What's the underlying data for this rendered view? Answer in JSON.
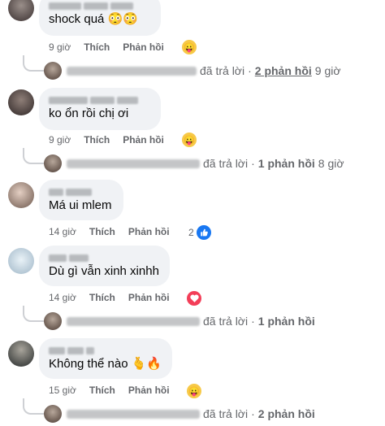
{
  "comments": [
    {
      "text": "shock quá 😳😳",
      "time": "9 giờ",
      "like": "Thích",
      "reply": "Phản hồi",
      "reaction": "haha-icon",
      "reply_summary": {
        "verb": "đã trả lời",
        "sep": "·",
        "count": "2 phản hồi",
        "ago": "9 giờ"
      }
    },
    {
      "text": "ko ổn rồi chị ơi",
      "time": "9 giờ",
      "like": "Thích",
      "reply": "Phản hồi",
      "reaction": "haha-icon",
      "reply_summary": {
        "verb": "đã trả lời",
        "sep": "·",
        "count": "1 phản hồi",
        "ago": "8 giờ"
      }
    },
    {
      "text": "Má ui mlem",
      "time": "14 giờ",
      "like": "Thích",
      "reply": "Phản hồi",
      "reaction_count": "2",
      "reaction": "like-icon"
    },
    {
      "text": "Dù gì vẫn xinh xinhh",
      "time": "14 giờ",
      "like": "Thích",
      "reply": "Phản hồi",
      "reaction": "heart-icon",
      "reply_summary": {
        "verb": "đã trả lời",
        "sep": "·",
        "count": "1 phản hồi",
        "ago": ""
      }
    },
    {
      "text": "Không thể nào 🫰🔥",
      "time": "15 giờ",
      "like": "Thích",
      "reply": "Phản hồi",
      "reaction": "haha-icon",
      "reply_summary": {
        "verb": "đã trả lời",
        "sep": "·",
        "count": "2 phản hồi",
        "ago": ""
      }
    }
  ]
}
